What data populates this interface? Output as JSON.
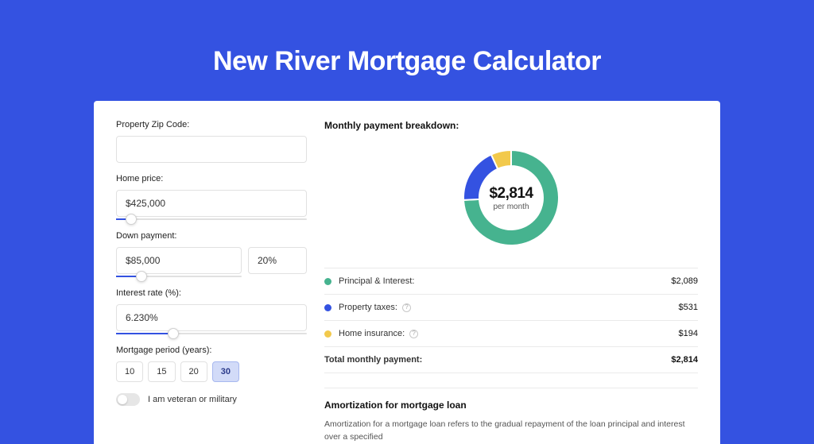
{
  "colors": {
    "pi": "#46b38f",
    "tax": "#3452e1",
    "ins": "#f2c94c"
  },
  "page": {
    "title": "New River Mortgage Calculator"
  },
  "form": {
    "zip": {
      "label": "Property Zip Code:",
      "value": ""
    },
    "home_price": {
      "label": "Home price:",
      "value": "$425,000",
      "slider_pct": 8
    },
    "down_payment": {
      "label": "Down payment:",
      "amount": "$85,000",
      "percent": "20%",
      "slider_pct": 20
    },
    "interest": {
      "label": "Interest rate (%):",
      "value": "6.230%",
      "slider_pct": 30
    },
    "period": {
      "label": "Mortgage period (years):",
      "options": [
        "10",
        "15",
        "20",
        "30"
      ],
      "selected": "30"
    },
    "veteran_label": "I am veteran or military"
  },
  "breakdown": {
    "title": "Monthly payment breakdown:",
    "center_value": "$2,814",
    "center_sub": "per month",
    "items": [
      {
        "label": "Principal & Interest:",
        "value": "$2,089",
        "color_key": "pi",
        "info": false
      },
      {
        "label": "Property taxes:",
        "value": "$531",
        "color_key": "tax",
        "info": true
      },
      {
        "label": "Home insurance:",
        "value": "$194",
        "color_key": "ins",
        "info": true
      }
    ],
    "total_label": "Total monthly payment:",
    "total_value": "$2,814"
  },
  "amortization": {
    "title": "Amortization for mortgage loan",
    "text": "Amortization for a mortgage loan refers to the gradual repayment of the loan principal and interest over a specified"
  },
  "chart_data": {
    "type": "pie",
    "title": "Monthly payment breakdown",
    "series": [
      {
        "name": "Principal & Interest",
        "value": 2089,
        "color": "#46b38f"
      },
      {
        "name": "Property taxes",
        "value": 531,
        "color": "#3452e1"
      },
      {
        "name": "Home insurance",
        "value": 194,
        "color": "#f2c94c"
      }
    ],
    "total": 2814,
    "unit": "USD per month"
  }
}
